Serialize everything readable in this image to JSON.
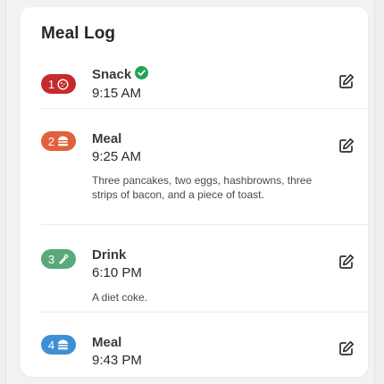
{
  "title": "Meal Log",
  "colors": {
    "snack": "#c62b2b",
    "meal_primary": "#e0623d",
    "drink": "#5aa97a",
    "meal_secondary": "#3e8fd6",
    "verified": "#22a456"
  },
  "entries": [
    {
      "number": "1",
      "type": "Snack",
      "time": "9:15 AM",
      "icon": "cookie-icon",
      "verified": true,
      "note": ""
    },
    {
      "number": "2",
      "type": "Meal",
      "time": "9:25 AM",
      "icon": "burger-icon",
      "verified": false,
      "note": "Three pancakes, two eggs, hashbrowns, three strips of bacon, and a piece of toast."
    },
    {
      "number": "3",
      "type": "Drink",
      "time": "6:10 PM",
      "icon": "bottle-icon",
      "verified": false,
      "note": "A diet coke."
    },
    {
      "number": "4",
      "type": "Meal",
      "time": "9:43 PM",
      "icon": "burger-icon",
      "verified": false,
      "note": ""
    }
  ],
  "edit_icon": "edit-icon"
}
